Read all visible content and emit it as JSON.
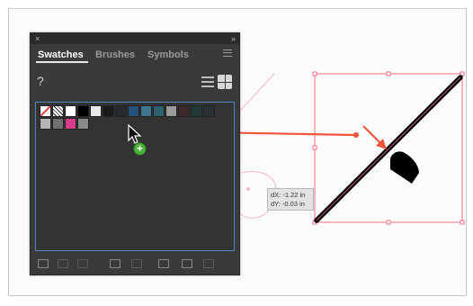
{
  "panel": {
    "close_glyph": "×",
    "collapse_glyph": "»",
    "tabs": [
      {
        "label": "Swatches",
        "active": true
      },
      {
        "label": "Brushes",
        "active": false
      },
      {
        "label": "Symbols",
        "active": false
      }
    ],
    "fill_stroke_glyph": "?",
    "swatches": [
      {
        "name": "none",
        "color": "#ffffff"
      },
      {
        "name": "registration",
        "color": "#cfcfcf"
      },
      {
        "name": "white",
        "color": "#ffffff"
      },
      {
        "name": "black",
        "color": "#000000"
      },
      {
        "name": "gray-1",
        "color": "#e8e8e8"
      },
      {
        "name": "dark-1",
        "color": "#1a1a1a"
      },
      {
        "name": "dark-2",
        "color": "#262a30"
      },
      {
        "name": "blue-1",
        "color": "#25537a"
      },
      {
        "name": "steel-1",
        "color": "#3e7591"
      },
      {
        "name": "teal-1",
        "color": "#2f5f6a"
      },
      {
        "name": "gray-2",
        "color": "#9a9a9a"
      },
      {
        "name": "brown-1",
        "color": "#3d2b2b"
      },
      {
        "name": "teal-2",
        "color": "#1f3a36"
      },
      {
        "name": "slate-1",
        "color": "#2a3134"
      },
      {
        "name": "gray-3",
        "color": "#b5b5b5"
      },
      {
        "name": "gray-4",
        "color": "#6f6f6f"
      },
      {
        "name": "magenta-1",
        "color": "#d83b8a"
      },
      {
        "name": "gray-5",
        "color": "#8a8a8a"
      }
    ]
  },
  "canvas": {
    "tooltip": {
      "dx": "dX: -1.22 in",
      "dy": "dY: -0.03 in"
    },
    "accent_color": "#f0543b",
    "selection_color": "#f06e86"
  }
}
